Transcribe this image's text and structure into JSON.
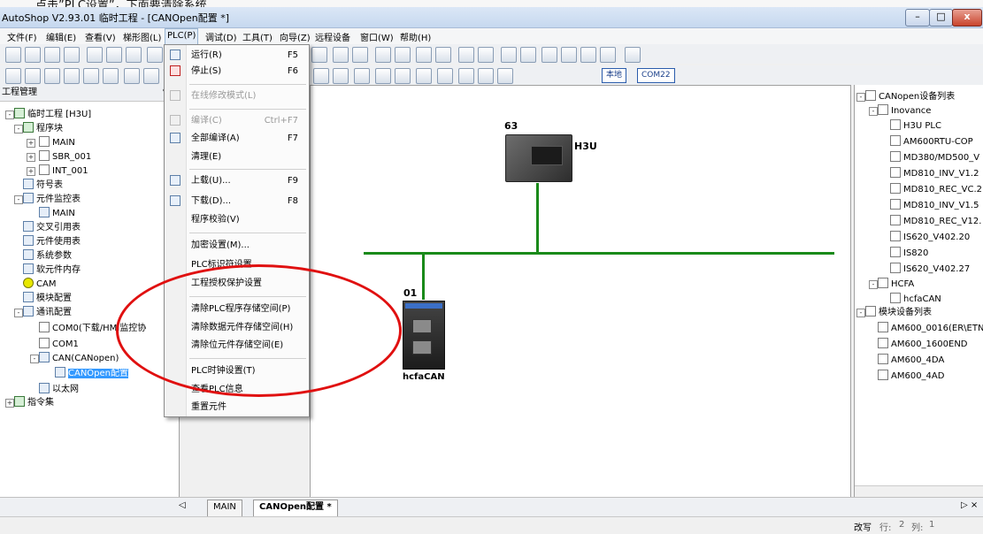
{
  "banner_text": "点击”PLC设置”，下面要清除系统",
  "window": {
    "title": "AutoShop V2.93.01 临时工程 - [CANOpen配置 *]"
  },
  "menubar": [
    "文件(F)",
    "编辑(E)",
    "查看(V)",
    "梯形图(L)",
    "PLC(P)",
    "调试(D)",
    "工具(T)",
    "向导(Z)",
    "远程设备",
    "窗口(W)",
    "帮助(H)"
  ],
  "toolbar": {
    "local_label": "本地",
    "port_label": "COM22"
  },
  "plc_menu": [
    {
      "label": "运行(R)",
      "shortcut": "F5"
    },
    {
      "label": "停止(S)",
      "shortcut": "F6"
    },
    {
      "label": "在线修改模式(L)",
      "shortcut": ""
    },
    {
      "label": "编译(C)",
      "shortcut": "Ctrl+F7"
    },
    {
      "label": "全部编译(A)",
      "shortcut": "F7"
    },
    {
      "label": "清理(E)",
      "shortcut": ""
    },
    {
      "label": "上载(U)...",
      "shortcut": "F9"
    },
    {
      "label": "下载(D)...",
      "shortcut": "F8"
    },
    {
      "label": "程序校验(V)",
      "shortcut": ""
    },
    {
      "label": "加密设置(M)...",
      "shortcut": ""
    },
    {
      "label": "PLC标识符设置",
      "shortcut": ""
    },
    {
      "label": "工程授权保护设置",
      "shortcut": ""
    },
    {
      "label": "清除PLC程序存储空间(P)",
      "shortcut": ""
    },
    {
      "label": "清除数据元件存储空间(H)",
      "shortcut": ""
    },
    {
      "label": "清除位元件存储空间(E)",
      "shortcut": ""
    },
    {
      "label": "PLC时钟设置(T)",
      "shortcut": ""
    },
    {
      "label": "查看PLC信息",
      "shortcut": ""
    },
    {
      "label": "重置元件",
      "shortcut": ""
    }
  ],
  "project_panel": {
    "title": "工程管理",
    "tree": [
      "临时工程 [H3U]",
      "程序块",
      "MAIN",
      "SBR_001",
      "INT_001",
      "符号表",
      "元件监控表",
      "MAIN",
      "交叉引用表",
      "元件使用表",
      "系统参数",
      "软元件内存",
      "CAM",
      "模块配置",
      "通讯配置",
      "COM0(下载/HMI监控协",
      "COM1",
      "CAN(CANopen)",
      "CANOpen配置",
      "以太网",
      "指令集"
    ]
  },
  "canvas": {
    "device1": {
      "id": "63",
      "label": "H3U"
    },
    "device2": {
      "id": "01",
      "label": "hcfaCAN"
    },
    "bus_color": "#1a8a1a"
  },
  "device_panel": {
    "tree": [
      "CANopen设备列表",
      "Inovance",
      "H3U PLC",
      "AM600RTU-COP",
      "MD380/MD500_V",
      "MD810_INV_V1.2",
      "MD810_REC_VC.2",
      "MD810_INV_V1.5",
      "MD810_REC_V12.",
      "IS620_V402.20",
      "IS820",
      "IS620_V402.27",
      "HCFA",
      "hcfaCAN",
      "模块设备列表",
      "AM600_0016(ER\\ETN",
      "AM600_1600END",
      "AM600_4DA",
      "AM600_4AD"
    ]
  },
  "tabs": [
    "MAIN",
    "CANOpen配置 *"
  ],
  "status": {
    "mode": "改写",
    "row_label": "行:",
    "row": "2",
    "col_label": "列:",
    "col": "1"
  },
  "colors": {
    "highlight_ellipse": "#e01010",
    "selection": "#3399ff"
  }
}
